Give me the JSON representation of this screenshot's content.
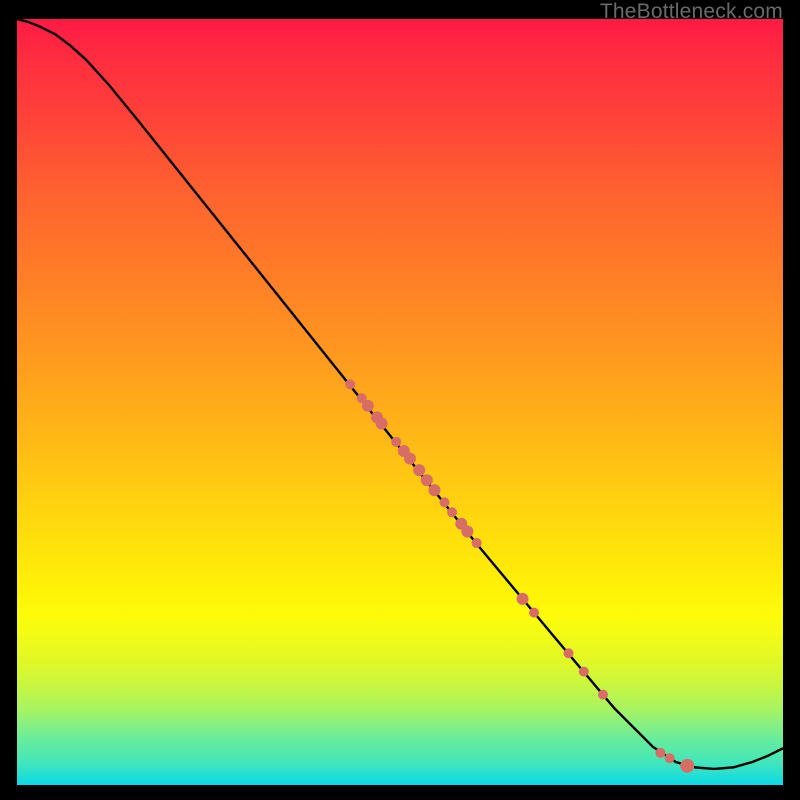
{
  "watermark": "TheBottleneck.com",
  "chart_data": {
    "type": "line",
    "title": "",
    "xlabel": "",
    "ylabel": "",
    "xlim": [
      0,
      100
    ],
    "ylim": [
      0,
      100
    ],
    "curve_points": [
      {
        "x": 0,
        "y": 100.0
      },
      {
        "x": 1.5,
        "y": 99.6
      },
      {
        "x": 3.0,
        "y": 99.0
      },
      {
        "x": 5.0,
        "y": 98.0
      },
      {
        "x": 7.0,
        "y": 96.5
      },
      {
        "x": 9.0,
        "y": 94.7
      },
      {
        "x": 12.0,
        "y": 91.4
      },
      {
        "x": 16.0,
        "y": 86.5
      },
      {
        "x": 22.0,
        "y": 79.0
      },
      {
        "x": 30.0,
        "y": 69.0
      },
      {
        "x": 40.0,
        "y": 56.5
      },
      {
        "x": 50.0,
        "y": 44.0
      },
      {
        "x": 60.0,
        "y": 31.5
      },
      {
        "x": 70.0,
        "y": 19.5
      },
      {
        "x": 78.0,
        "y": 10.0
      },
      {
        "x": 83.0,
        "y": 5.0
      },
      {
        "x": 86.0,
        "y": 3.0
      },
      {
        "x": 88.5,
        "y": 2.3
      },
      {
        "x": 91.0,
        "y": 2.1
      },
      {
        "x": 93.5,
        "y": 2.3
      },
      {
        "x": 96.0,
        "y": 3.0
      },
      {
        "x": 98.0,
        "y": 3.8
      },
      {
        "x": 100.0,
        "y": 4.8
      }
    ],
    "highlight_points": [
      {
        "x": 43.5,
        "y": 52.3,
        "r": 5
      },
      {
        "x": 45.0,
        "y": 50.5,
        "r": 5
      },
      {
        "x": 45.8,
        "y": 49.5,
        "r": 6
      },
      {
        "x": 47.0,
        "y": 48.0,
        "r": 6
      },
      {
        "x": 47.6,
        "y": 47.2,
        "r": 6
      },
      {
        "x": 49.5,
        "y": 44.8,
        "r": 5
      },
      {
        "x": 50.5,
        "y": 43.6,
        "r": 6
      },
      {
        "x": 51.3,
        "y": 42.6,
        "r": 6
      },
      {
        "x": 52.5,
        "y": 41.1,
        "r": 6
      },
      {
        "x": 53.5,
        "y": 39.8,
        "r": 6
      },
      {
        "x": 54.5,
        "y": 38.5,
        "r": 6
      },
      {
        "x": 55.8,
        "y": 36.9,
        "r": 5
      },
      {
        "x": 56.8,
        "y": 35.6,
        "r": 5
      },
      {
        "x": 58.0,
        "y": 34.1,
        "r": 6
      },
      {
        "x": 58.8,
        "y": 33.1,
        "r": 6
      },
      {
        "x": 60.0,
        "y": 31.6,
        "r": 5
      },
      {
        "x": 66.0,
        "y": 24.3,
        "r": 6
      },
      {
        "x": 67.5,
        "y": 22.5,
        "r": 5
      },
      {
        "x": 72.0,
        "y": 17.2,
        "r": 5
      },
      {
        "x": 74.0,
        "y": 14.8,
        "r": 5
      },
      {
        "x": 76.5,
        "y": 11.8,
        "r": 5
      },
      {
        "x": 84.0,
        "y": 4.2,
        "r": 5
      },
      {
        "x": 85.2,
        "y": 3.5,
        "r": 5
      },
      {
        "x": 87.5,
        "y": 2.5,
        "r": 7
      }
    ],
    "point_color": "#d86d66"
  }
}
